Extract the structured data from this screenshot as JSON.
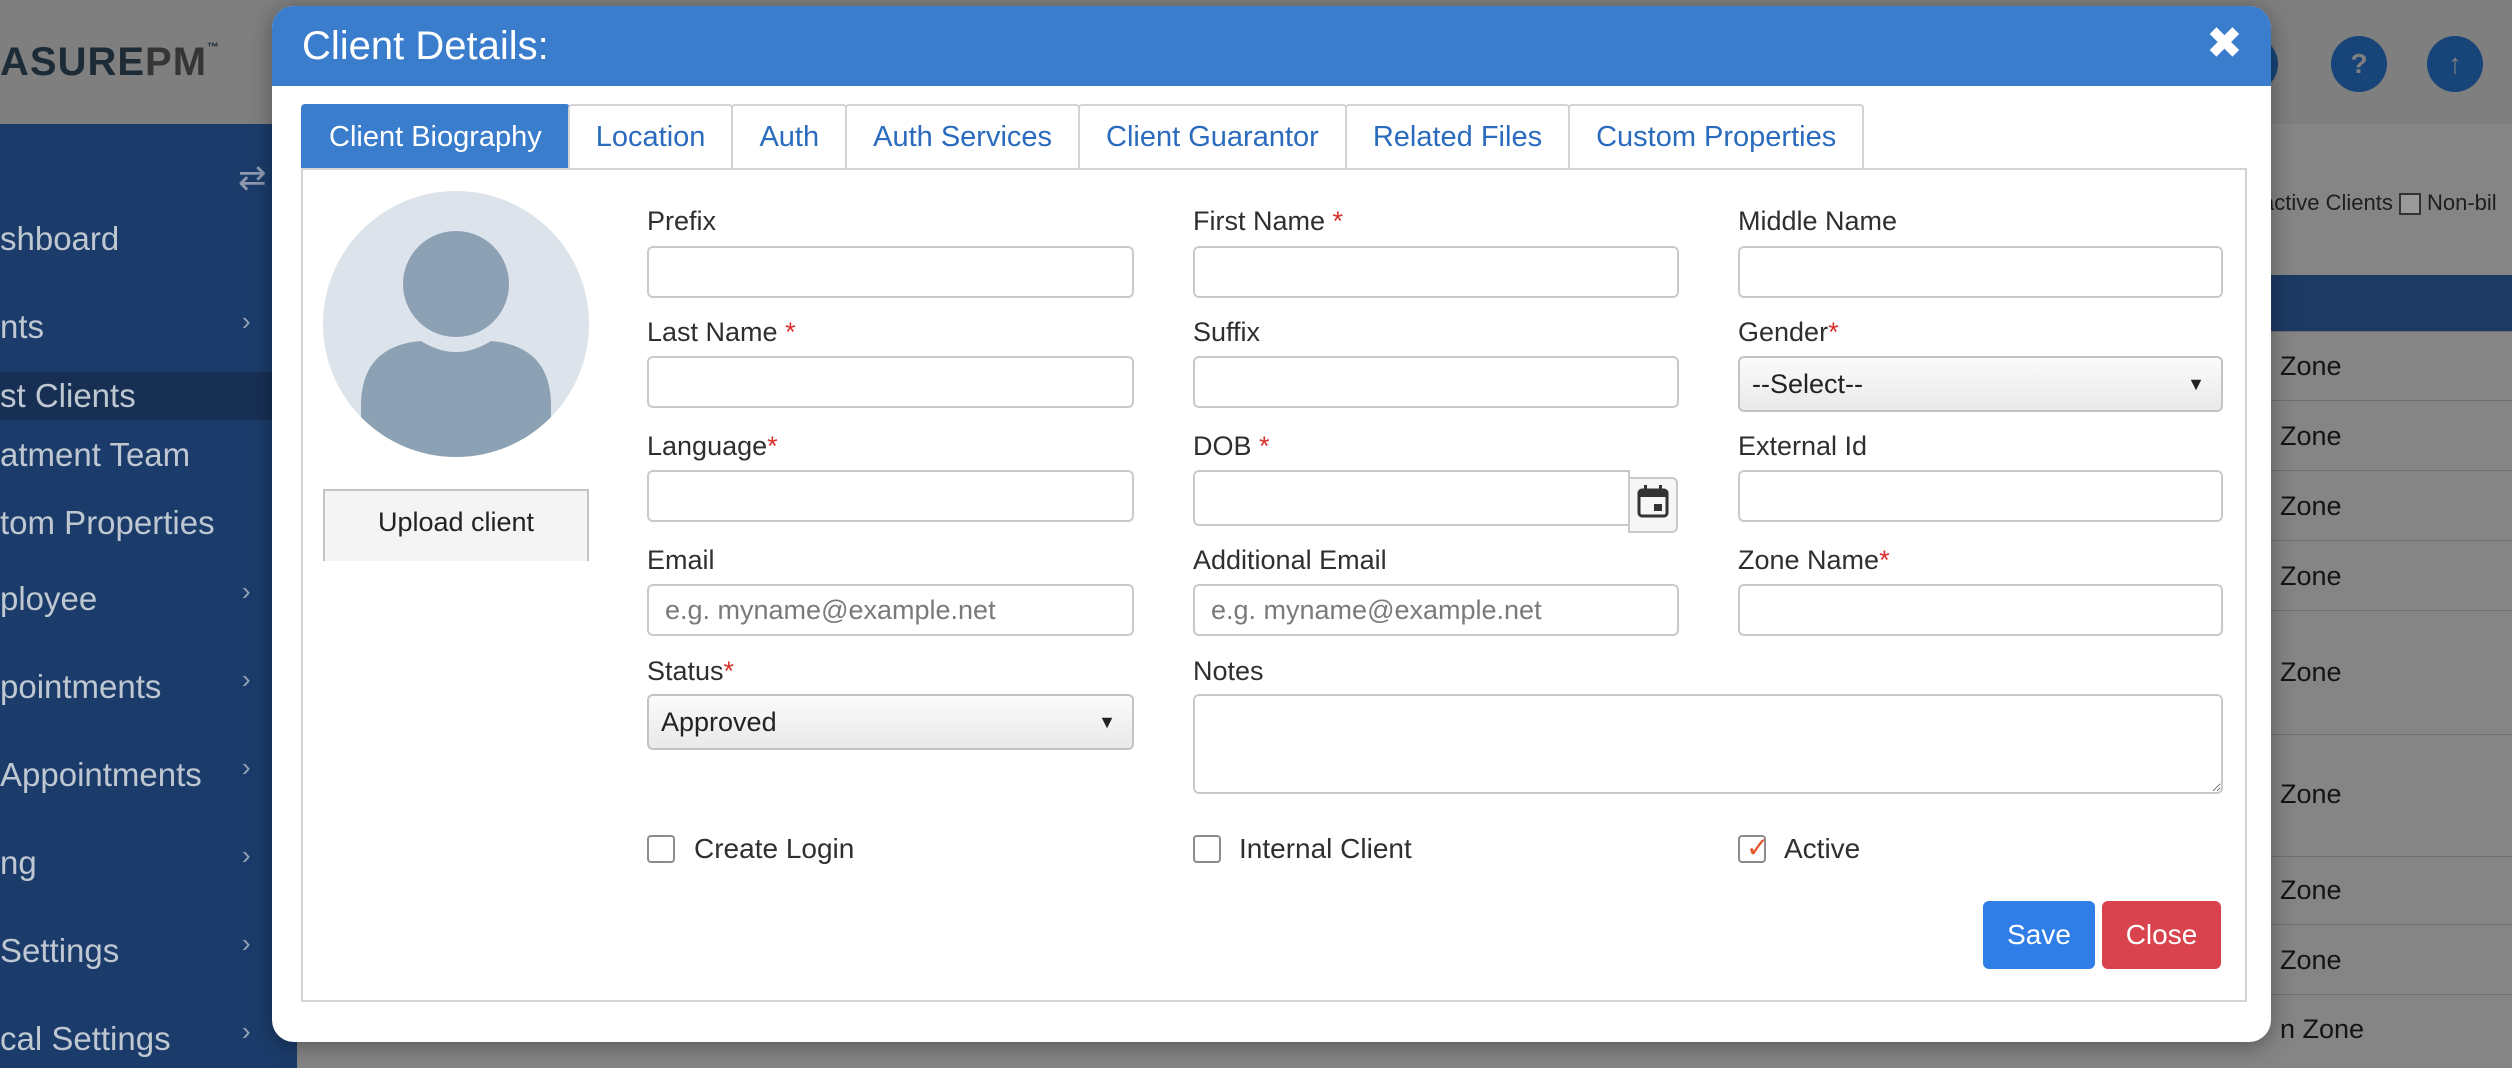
{
  "background": {
    "logo_main": "ASURE",
    "logo_pm": "PM",
    "logo_tm": "™",
    "collapse_icon": "⇄",
    "header_icons": [
      "?",
      "?",
      "↑"
    ],
    "filter_text": "active Clients",
    "filter_text2": "Non-bil",
    "sidebar_items": [
      "shboard",
      "nts",
      "st Clients",
      "atment Team",
      "tom Properties",
      "ployee",
      "pointments",
      "Appointments",
      "ng",
      "Settings",
      "cal Settings"
    ],
    "zone_cells": [
      "Zone",
      "Zone",
      "Zone",
      "Zone",
      "Zone",
      "Zone",
      "Zone",
      "Zone",
      "n Zone"
    ]
  },
  "modal": {
    "title": "Client Details:",
    "close_glyph": "✖",
    "tabs": [
      {
        "label": "Client Biography",
        "active": true
      },
      {
        "label": "Location",
        "active": false
      },
      {
        "label": "Auth",
        "active": false
      },
      {
        "label": "Auth Services",
        "active": false
      },
      {
        "label": "Client Guarantor",
        "active": false
      },
      {
        "label": "Related Files",
        "active": false
      },
      {
        "label": "Custom Properties",
        "active": false
      }
    ],
    "upload_button": "Upload client",
    "fields": {
      "prefix": {
        "label": "Prefix",
        "value": ""
      },
      "first_name": {
        "label": "First Name",
        "required": "*",
        "value": ""
      },
      "middle_name": {
        "label": "Middle Name",
        "value": ""
      },
      "last_name": {
        "label": "Last Name",
        "required": "*",
        "value": ""
      },
      "suffix": {
        "label": "Suffix",
        "value": ""
      },
      "gender": {
        "label": "Gender",
        "required": "*",
        "selected": "--Select--"
      },
      "language": {
        "label": "Language",
        "required": "*",
        "value": ""
      },
      "dob": {
        "label": "DOB",
        "required": "*",
        "value": ""
      },
      "external_id": {
        "label": "External Id",
        "value": ""
      },
      "email": {
        "label": "Email",
        "placeholder": "e.g. myname@example.net"
      },
      "additional_email": {
        "label": "Additional Email",
        "placeholder": "e.g. myname@example.net"
      },
      "zone_name": {
        "label": "Zone Name",
        "required": "*",
        "value": ""
      },
      "status": {
        "label": "Status",
        "required": "*",
        "selected": "Approved"
      },
      "notes": {
        "label": "Notes",
        "value": ""
      }
    },
    "checkboxes": {
      "create_login": {
        "label": "Create Login",
        "checked": false
      },
      "internal_client": {
        "label": "Internal Client",
        "checked": false
      },
      "active": {
        "label": "Active",
        "checked": true
      }
    },
    "check_glyph": "✓",
    "select_arrow": "▼",
    "save_label": "Save",
    "close_label": "Close"
  },
  "colors": {
    "header_blue": "#3b7dcd",
    "save_blue": "#2f7ee8",
    "close_red": "#d9434e",
    "required_red": "#d9302b",
    "check_orange": "#e2572b"
  }
}
